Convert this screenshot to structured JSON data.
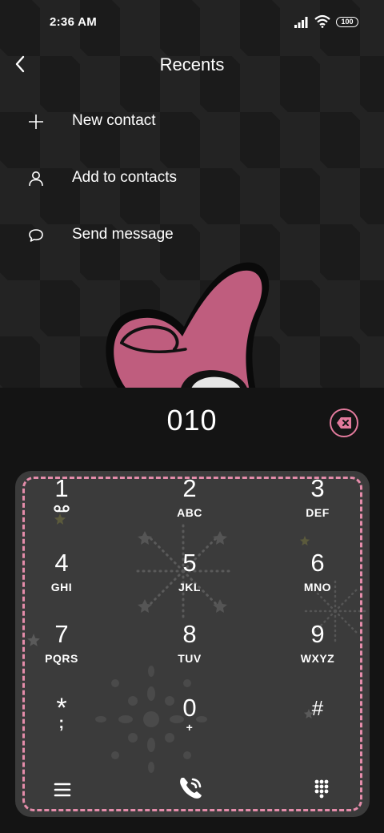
{
  "status_bar": {
    "time": "2:36 AM",
    "battery": "100"
  },
  "header": {
    "title": "Recents"
  },
  "menu": [
    {
      "label": "New contact",
      "icon": "plus-icon"
    },
    {
      "label": "Add to contacts",
      "icon": "person-icon"
    },
    {
      "label": "Send message",
      "icon": "message-icon"
    }
  ],
  "dialer": {
    "number": "010"
  },
  "keys": [
    {
      "digit": "1",
      "letters": ""
    },
    {
      "digit": "2",
      "letters": "ABC"
    },
    {
      "digit": "3",
      "letters": "DEF"
    },
    {
      "digit": "4",
      "letters": "GHI"
    },
    {
      "digit": "5",
      "letters": "JKL"
    },
    {
      "digit": "6",
      "letters": "MNO"
    },
    {
      "digit": "7",
      "letters": "PQRS"
    },
    {
      "digit": "8",
      "letters": "TUV"
    },
    {
      "digit": "9",
      "letters": "WXYZ"
    },
    {
      "digit": "*",
      "letters": ";"
    },
    {
      "digit": "0",
      "letters": "+"
    },
    {
      "digit": "#",
      "letters": ""
    }
  ],
  "colors": {
    "accent": "#e27a9c",
    "keypad_bg": "#3b3b3b",
    "background": "#141414"
  },
  "icons": {
    "bottom_left": "menu-icon",
    "bottom_center": "call-icon",
    "bottom_right": "dialpad-icon"
  }
}
